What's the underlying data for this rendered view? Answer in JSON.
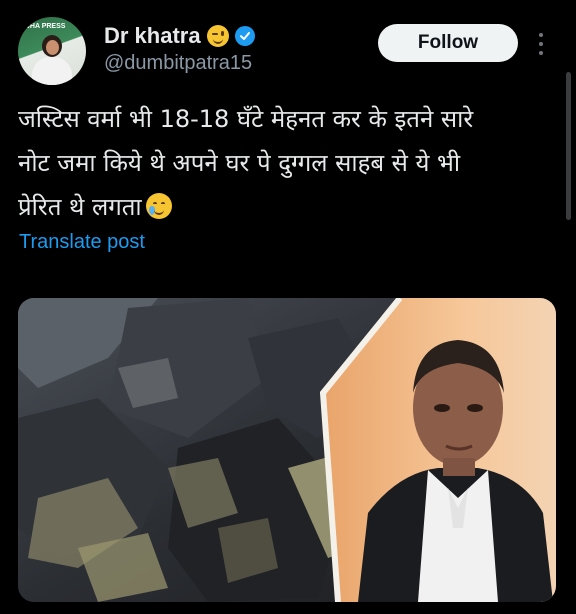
{
  "app": "X",
  "post": {
    "author": {
      "display_name": "Dr khatra",
      "handle": "@dumbitpatra15",
      "verified": true,
      "name_emoji": "winking-face-emoji",
      "avatar_text": "JHA PRESS"
    },
    "follow_label": "Follow",
    "more_icon": "more-vertical-icon",
    "text": "जस्टिस वर्मा भी 18-18 घँटे मेहनत कर के इतने सारे\nनोट जमा किये थे अपने घर पे दुग्गल साहब से ये भी\nप्रेरित थे लगता",
    "text_emoji": "smiling-face-with-tear-emoji",
    "translate_label": "Translate post",
    "media": {
      "type": "image",
      "description_icons": [
        "burnt-cash-photo",
        "judge-portrait-photo"
      ]
    }
  },
  "colors": {
    "background": "#000000",
    "text": "#e7e9ea",
    "secondary_text": "#8b98a5",
    "accent": "#1d9bf0",
    "button_bg": "#eff3f4"
  }
}
